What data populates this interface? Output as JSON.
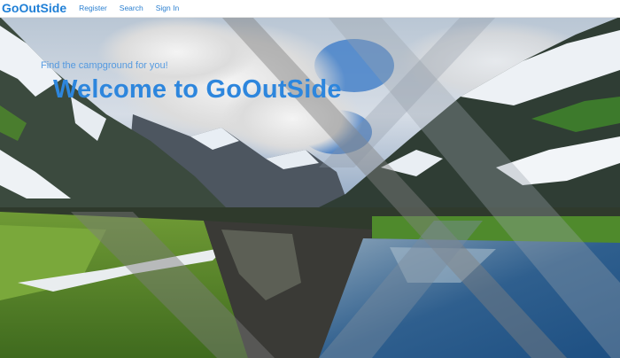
{
  "navbar": {
    "brand": "GoOutSide",
    "links": [
      "Register",
      "Search",
      "Sign In"
    ]
  },
  "hero": {
    "tagline": "Find the campground for you!",
    "headline": "Welcome to GoOutSide"
  },
  "colors": {
    "accent": "#2d86dd",
    "navbar_bg": "#ffffff"
  }
}
